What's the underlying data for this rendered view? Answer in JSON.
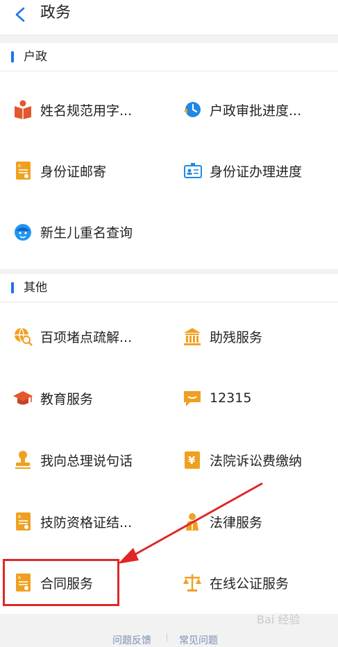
{
  "header": {
    "title": "政务"
  },
  "sections": [
    {
      "title": "户政",
      "items": [
        {
          "label": "姓名规范用字...",
          "icon": "book-icon"
        },
        {
          "label": "户政审批进度...",
          "icon": "clock-progress-icon"
        },
        {
          "label": "身份证邮寄",
          "icon": "document-icon"
        },
        {
          "label": "身份证办理进度",
          "icon": "id-card-icon"
        },
        {
          "label": "新生儿重名查询",
          "icon": "baby-face-icon"
        }
      ]
    },
    {
      "title": "其他",
      "items": [
        {
          "label": "百项堵点疏解...",
          "icon": "globe-search-icon"
        },
        {
          "label": "助残服务",
          "icon": "building-icon"
        },
        {
          "label": "教育服务",
          "icon": "graduation-cap-icon"
        },
        {
          "label": "12315",
          "icon": "chat-bubble-icon"
        },
        {
          "label": "我向总理说句话",
          "icon": "stamp-icon"
        },
        {
          "label": "法院诉讼费缴纳",
          "icon": "yuan-receipt-icon"
        },
        {
          "label": "技防资格证结...",
          "icon": "document-icon"
        },
        {
          "label": "法律服务",
          "icon": "person-law-icon"
        },
        {
          "label": "合同服务",
          "icon": "document-icon"
        },
        {
          "label": "在线公证服务",
          "icon": "scales-icon"
        }
      ]
    }
  ],
  "footer": {
    "link1": "问题反馈",
    "link2": "常见问题"
  },
  "watermark": "Bai 经验",
  "colors": {
    "accent": "#1e73e8",
    "icon_orange": "#f0a020",
    "icon_red": "#e2572b",
    "highlight": "#e02626"
  }
}
